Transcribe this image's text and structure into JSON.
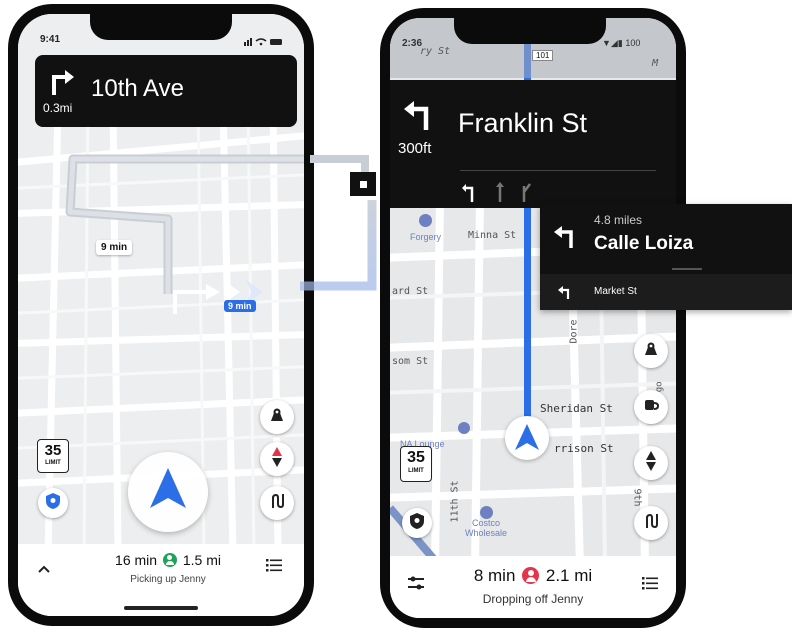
{
  "left_phone": {
    "status_time": "9:41",
    "banner": {
      "distance": "0.3mi",
      "street": "10th Ave"
    },
    "route_labels": {
      "alt_time": "9 min",
      "main_time": "9 min"
    },
    "speed_limit": {
      "value": "35",
      "label": "LIMIT"
    },
    "bottom": {
      "eta": "16 min",
      "distance": "1.5 mi",
      "status": "Picking up Jenny"
    }
  },
  "right_phone": {
    "status_time": "2:36",
    "status_right": "100",
    "route_shield": "101",
    "banner": {
      "distance": "300ft",
      "street": "Franklin St"
    },
    "popover": {
      "distance": "4.8 miles",
      "street": "Calle Loiza",
      "next": "Market St"
    },
    "streets": {
      "minna": "Minna St",
      "ard": "ard St",
      "som": "som St",
      "sheridan": "Sheridan St",
      "harrison": "rrison St",
      "eleventh": "11th St",
      "dore": "Dore",
      "ninth": "9th",
      "top_st": "ry St",
      "top_right": "M",
      "diego": "Diego"
    },
    "pois": {
      "forgery": "Forgery",
      "lounge": "NA Lounge",
      "costco": "Costco\nWholesale"
    },
    "speed_limit": {
      "value": "35",
      "label": "LIMIT"
    },
    "bottom": {
      "eta": "8 min",
      "distance": "2.1 mi",
      "status": "Dropping off Jenny"
    }
  },
  "colors": {
    "route_blue": "#2b6ee8",
    "pickup_green": "#1fa35a",
    "dropoff_red": "#e5334b"
  }
}
